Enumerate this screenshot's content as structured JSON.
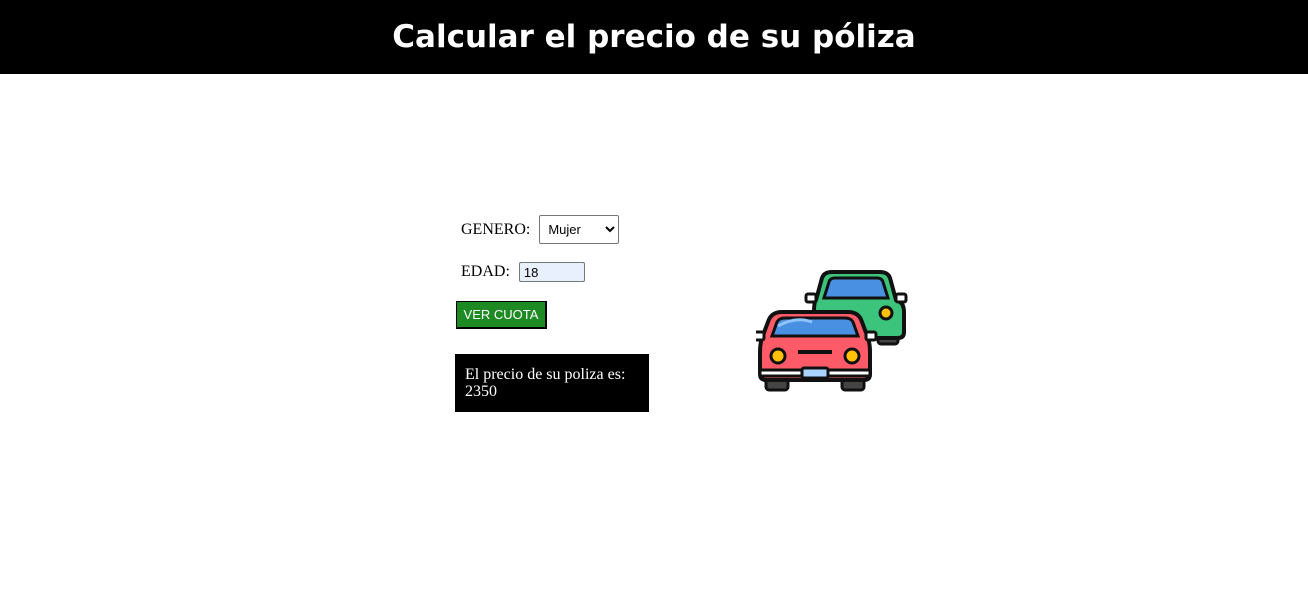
{
  "header": {
    "title": "Calcular el precio de su póliza"
  },
  "form": {
    "genero_label": "GENERO:",
    "genero_selected": "Mujer",
    "edad_label": "EDAD:",
    "edad_value": "18",
    "submit_label": "VER CUOTA"
  },
  "result": {
    "text": "El precio de su poliza es:",
    "value": "2350"
  },
  "colors": {
    "header_bg": "#000000",
    "button_bg": "#1d8a23",
    "result_bg": "#000000",
    "input_bg": "#e8f0fe"
  },
  "icons": {
    "illustration": "cars-icon"
  }
}
